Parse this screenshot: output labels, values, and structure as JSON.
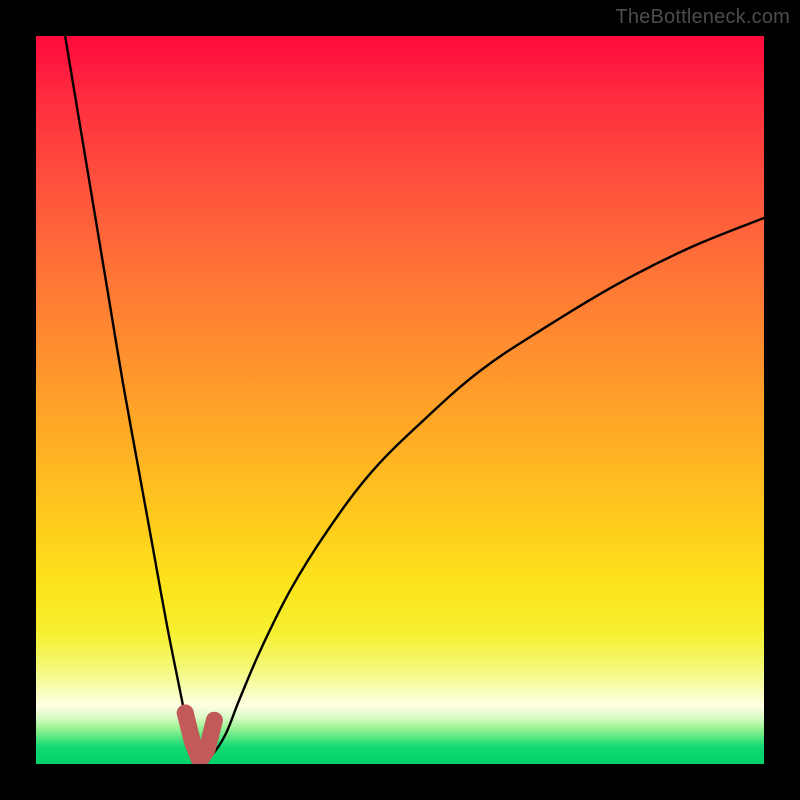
{
  "watermark": "TheBottleneck.com",
  "colors": {
    "frame": "#000000",
    "curve_stroke": "#000000",
    "marker_stroke": "#c25a5a",
    "marker_fill": "#c25a5a",
    "gradient_top": "#ff0a3c",
    "gradient_bottom": "#00d16a"
  },
  "chart_data": {
    "type": "line",
    "title": "",
    "xlabel": "",
    "ylabel": "",
    "xlim": [
      0,
      100
    ],
    "ylim": [
      0,
      100
    ],
    "grid": false,
    "legend": false,
    "description": "Bottleneck percentage curve. The valley (near-zero bottleneck) occurs around x≈22. The left branch rises steeply toward 100% as x→0; the right branch rises more gradually toward ~75-80% as x→100.",
    "series": [
      {
        "name": "bottleneck-curve",
        "x": [
          4,
          6,
          8,
          10,
          12,
          14,
          16,
          18,
          20,
          21,
          22,
          23,
          24,
          26,
          28,
          31,
          35,
          40,
          46,
          53,
          61,
          70,
          80,
          90,
          100
        ],
        "y": [
          100,
          88,
          76,
          64,
          52,
          41,
          30,
          19,
          9,
          4,
          1,
          0.5,
          1,
          4,
          9,
          16,
          24,
          32,
          40,
          47,
          54,
          60,
          66,
          71,
          75
        ]
      }
    ],
    "markers": {
      "name": "valley-highlight",
      "x": [
        20.5,
        21.5,
        22.5,
        23.5,
        24.5
      ],
      "y": [
        7,
        3,
        0.5,
        2,
        6
      ]
    }
  }
}
